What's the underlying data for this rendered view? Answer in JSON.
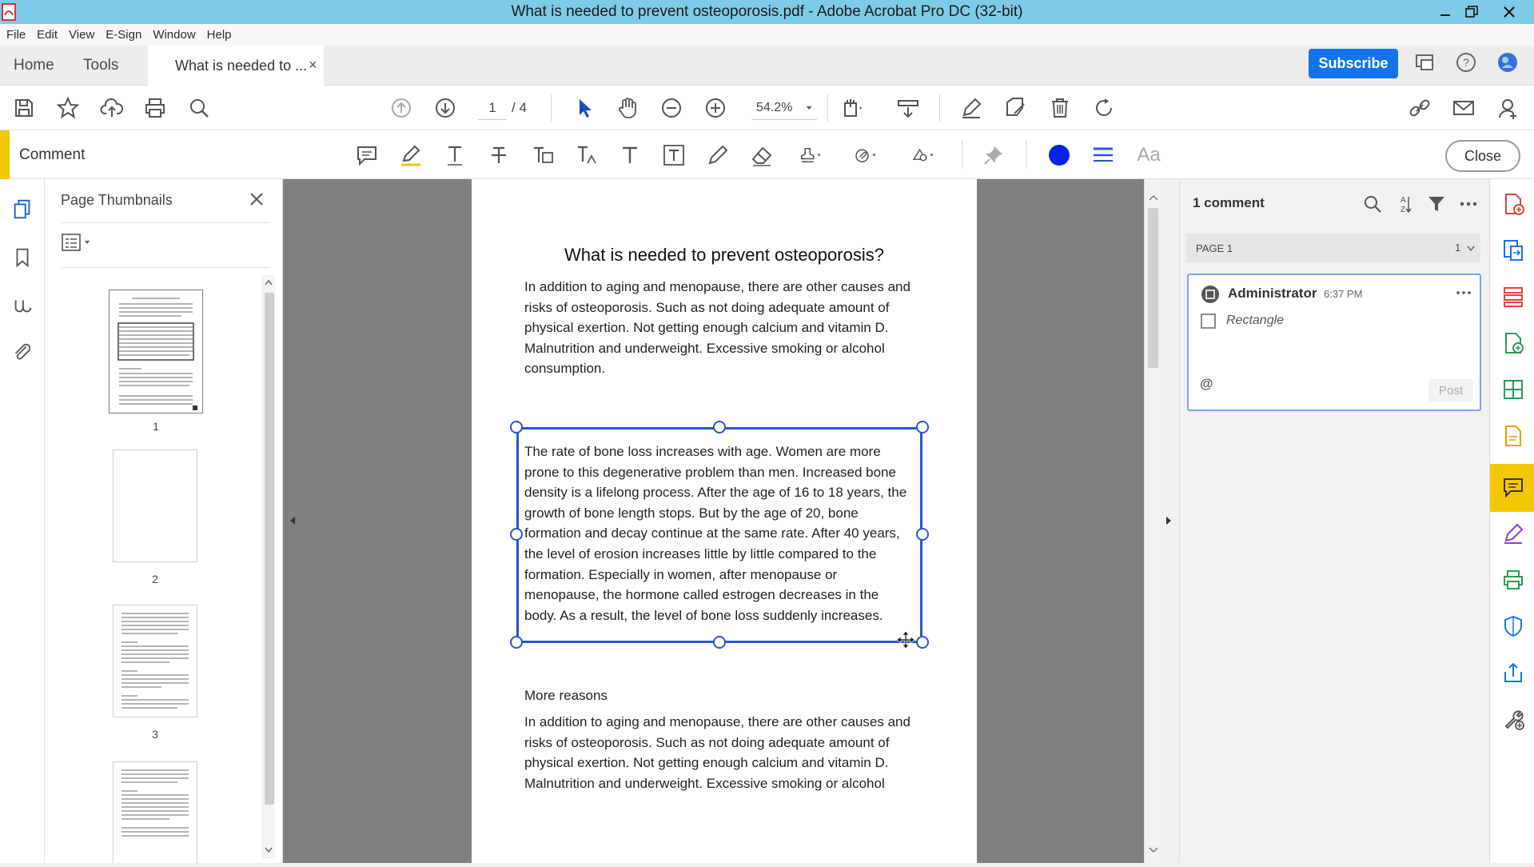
{
  "window": {
    "title": "What is needed to prevent osteoporosis.pdf - Adobe Acrobat Pro DC (32-bit)"
  },
  "menu": [
    "File",
    "Edit",
    "View",
    "E-Sign",
    "Window",
    "Help"
  ],
  "tabs": {
    "home": "Home",
    "tools": "Tools",
    "document": "What is needed to ...",
    "close_glyph": "×"
  },
  "header": {
    "subscribe": "Subscribe"
  },
  "toolbar": {
    "page_current": "1",
    "page_total": "/ 4",
    "zoom": "54.2%"
  },
  "comment_bar": {
    "title": "Comment",
    "font_label": "Aa",
    "close_label": "Close",
    "color": "#0a22e6"
  },
  "thumbnails": {
    "title": "Page Thumbnails",
    "pages": [
      {
        "number": "1"
      },
      {
        "number": "2"
      },
      {
        "number": "3"
      }
    ]
  },
  "document": {
    "heading": "What is needed to prevent osteoporosis?",
    "p1": [
      "In addition to aging and menopause, there are other causes and",
      "risks of osteoporosis. Such as not doing adequate amount of",
      "physical exertion. Not getting enough calcium and vitamin D.",
      "Malnutrition and underweight. Excessive smoking or alcohol",
      "consumption."
    ],
    "p2": [
      "The rate of bone loss increases with age. Women are more",
      "prone to this degenerative problem than men. Increased bone",
      "density is a lifelong process. After the age of 16 to 18 years, the",
      "growth of bone length stops. But by the age of 20, bone",
      "formation and decay continue at the same rate. After 40 years,",
      "the level of erosion increases little by little compared to the",
      "formation. Especially in women, after menopause or",
      "menopause, the hormone called estrogen decreases in the",
      "body. As a result, the level of bone loss suddenly increases."
    ],
    "subheading": "More reasons",
    "p3": [
      "In addition to aging and menopause, there are other causes and",
      "risks of osteoporosis. Such as not doing adequate amount of",
      "physical exertion. Not getting enough calcium and vitamin D.",
      "Malnutrition and underweight. Excessive smoking or alcohol"
    ]
  },
  "comments": {
    "count_label": "1 comment",
    "group_label": "PAGE 1",
    "group_count": "1",
    "author": "Administrator",
    "time": "6:37 PM",
    "type": "Rectangle",
    "mention_glyph": "@",
    "post_label": "Post"
  }
}
